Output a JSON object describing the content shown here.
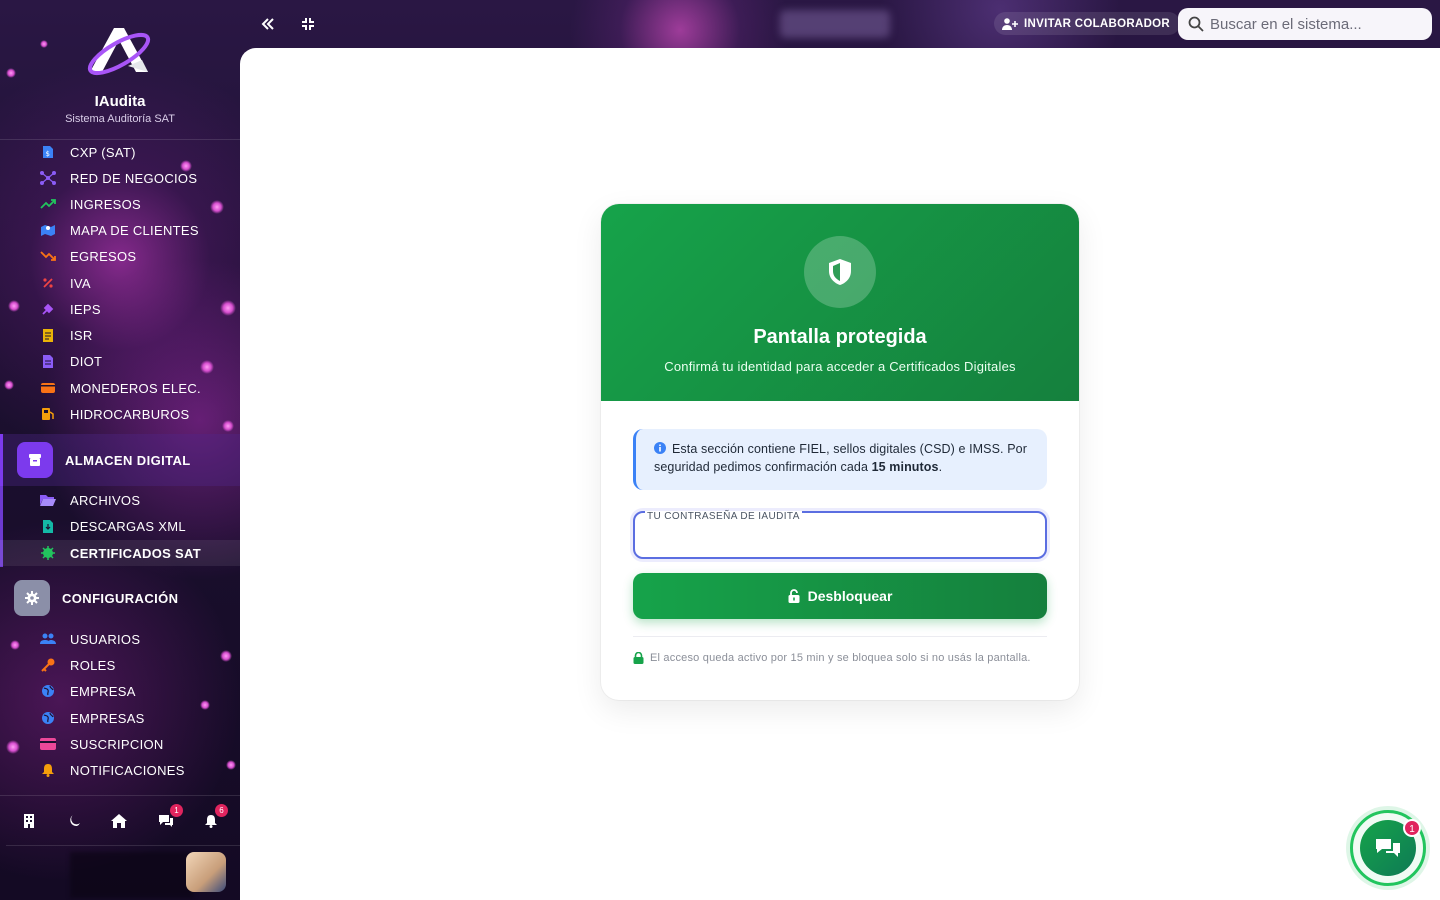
{
  "brand": {
    "name": "IAudita",
    "subtitle": "Sistema Auditoría SAT"
  },
  "sidebar": {
    "items": [
      {
        "label": "CXP (SAT)",
        "icon": "file-dollar-icon",
        "color": "#3b82f6"
      },
      {
        "label": "RED DE NEGOCIOS",
        "icon": "network-icon",
        "color": "#8b5cf6"
      },
      {
        "label": "INGRESOS",
        "icon": "trending-up-icon",
        "color": "#22c55e"
      },
      {
        "label": "MAPA DE CLIENTES",
        "icon": "map-icon",
        "color": "#3b82f6"
      },
      {
        "label": "EGRESOS",
        "icon": "trending-down-icon",
        "color": "#f97316"
      },
      {
        "label": "IVA",
        "icon": "percent-icon",
        "color": "#ef4444"
      },
      {
        "label": "IEPS",
        "icon": "wine-icon",
        "color": "#a855f7"
      },
      {
        "label": "ISR",
        "icon": "receipt-icon",
        "color": "#eab308"
      },
      {
        "label": "DIOT",
        "icon": "file-icon",
        "color": "#8b5cf6"
      },
      {
        "label": "MONEDEROS ELEC.",
        "icon": "wallet-icon",
        "color": "#f97316"
      },
      {
        "label": "HIDROCARBUROS",
        "icon": "gas-pump-icon",
        "color": "#f59e0b"
      }
    ],
    "groups": [
      {
        "label": "ALMACEN DIGITAL",
        "icon": "archive-icon",
        "color": "#7c3aed"
      },
      {
        "label": "CONFIGURACIÓN",
        "icon": "gear-icon",
        "color": "#8b8fa8"
      }
    ],
    "almacen_items": [
      {
        "label": "ARCHIVOS",
        "icon": "folder-open-icon",
        "color": "#8b5cf6"
      },
      {
        "label": "DESCARGAS XML",
        "icon": "file-download-icon",
        "color": "#14b8a6"
      },
      {
        "label": "CERTIFICADOS SAT",
        "icon": "certificate-icon",
        "color": "#22c55e"
      }
    ],
    "config_items": [
      {
        "label": "USUARIOS",
        "icon": "users-icon",
        "color": "#3b82f6"
      },
      {
        "label": "ROLES",
        "icon": "key-icon",
        "color": "#f97316"
      },
      {
        "label": "EMPRESA",
        "icon": "globe-icon",
        "color": "#3b82f6"
      },
      {
        "label": "EMPRESAS",
        "icon": "globe-icon",
        "color": "#3b82f6"
      },
      {
        "label": "SUSCRIPCION",
        "icon": "credit-card-icon",
        "color": "#ec4899"
      },
      {
        "label": "NOTIFICACIONES",
        "icon": "bell-icon",
        "color": "#f59e0b"
      }
    ],
    "bottom_badges": {
      "chat": "1",
      "notifications": "6"
    }
  },
  "topbar": {
    "invite_label": "INVITAR COLABORADOR",
    "search_placeholder": "Buscar en el sistema..."
  },
  "lock_card": {
    "title": "Pantalla protegida",
    "subtitle": "Confirmá tu identidad para acceder a Certificados Digitales",
    "info_text_1": "Esta sección contiene FIEL, sellos digitales (CSD) e IMSS. Por seguridad pedimos confirmación cada ",
    "info_bold": "15 minutos",
    "info_end": ".",
    "password_label": "TU CONTRASEÑA DE IAUDITA",
    "password_value": "",
    "unlock_label": "Desbloquear",
    "footnote": "El acceso queda activo por 15 min y se bloquea solo si no usás la pantalla."
  },
  "chat_fab": {
    "badge": "1"
  },
  "colors": {
    "accent_green": "#16a34a",
    "accent_purple": "#7c3aed",
    "info_blue": "#3b82f6"
  }
}
